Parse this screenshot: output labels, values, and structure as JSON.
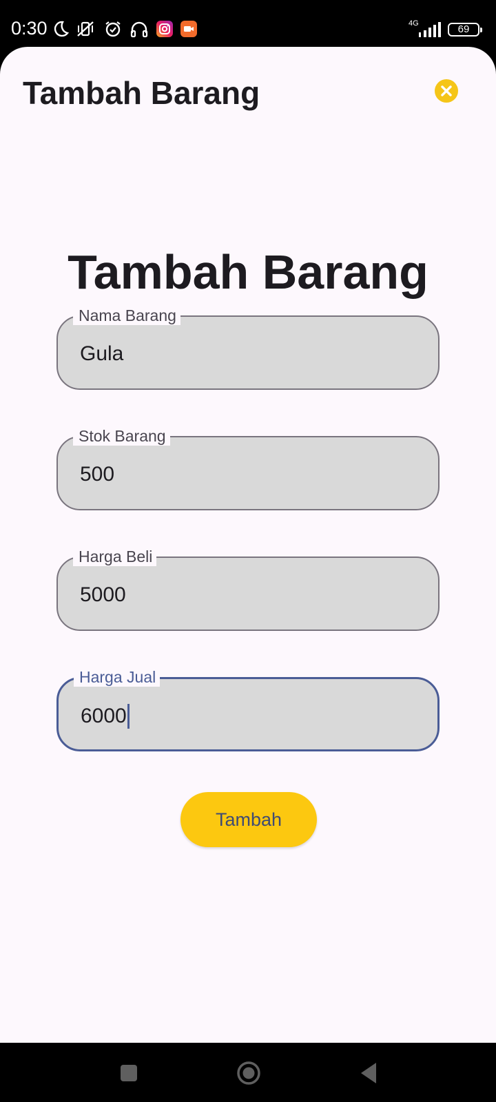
{
  "status_bar": {
    "time": "0:30",
    "network": "4G",
    "battery": "69",
    "icons": [
      "moon-icon",
      "vibrate-off-icon",
      "alarm-icon",
      "headphones-icon",
      "instagram-icon",
      "video-app-icon",
      "signal-icon",
      "battery-icon"
    ]
  },
  "sheet": {
    "title": "Tambah Barang",
    "close_icon": "close-icon",
    "accent_color": "#f5c518"
  },
  "form": {
    "heading": "Tambah Barang",
    "fields": [
      {
        "label": "Nama Barang",
        "value": "Gula",
        "focused": false
      },
      {
        "label": "Stok Barang",
        "value": "500",
        "focused": false
      },
      {
        "label": "Harga Beli",
        "value": "5000",
        "focused": false
      },
      {
        "label": "Harga Jual",
        "value": "6000",
        "focused": true
      }
    ],
    "submit_label": "Tambah",
    "focus_color": "#4a5c96",
    "button_color": "#fcc810"
  },
  "nav_bar": {
    "buttons": [
      "recents-icon",
      "home-icon",
      "back-icon"
    ]
  }
}
